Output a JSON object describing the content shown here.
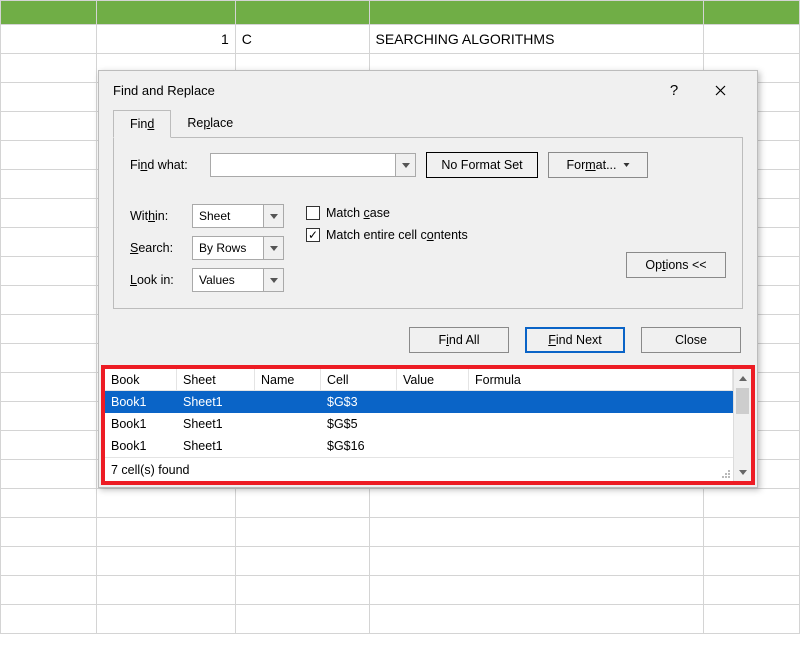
{
  "sheet": {
    "row2": {
      "b": "1",
      "c": "C",
      "d": "SEARCHING ALGORITHMS"
    }
  },
  "dialog": {
    "title": "Find and Replace",
    "tabs": {
      "find": "Find",
      "replace": "Replace"
    },
    "labels": {
      "find_what": "Find what:",
      "within": "Within:",
      "search": "Search:",
      "look_in": "Look in:"
    },
    "selects": {
      "within": "Sheet",
      "search": "By Rows",
      "look_in": "Values"
    },
    "checks": {
      "match_case": "Match case",
      "match_entire": "Match entire cell contents"
    },
    "buttons": {
      "no_format": "No Format Set",
      "format": "Format...",
      "options": "Options <<",
      "find_all": "Find All",
      "find_next": "Find Next",
      "close": "Close"
    },
    "results": {
      "headers": {
        "book": "Book",
        "sheet": "Sheet",
        "name": "Name",
        "cell": "Cell",
        "value": "Value",
        "formula": "Formula"
      },
      "rows": [
        {
          "book": "Book1",
          "sheet": "Sheet1",
          "name": "",
          "cell": "$G$3",
          "value": "",
          "formula": ""
        },
        {
          "book": "Book1",
          "sheet": "Sheet1",
          "name": "",
          "cell": "$G$5",
          "value": "",
          "formula": ""
        },
        {
          "book": "Book1",
          "sheet": "Sheet1",
          "name": "",
          "cell": "$G$16",
          "value": "",
          "formula": ""
        }
      ],
      "status": "7 cell(s) found"
    }
  }
}
